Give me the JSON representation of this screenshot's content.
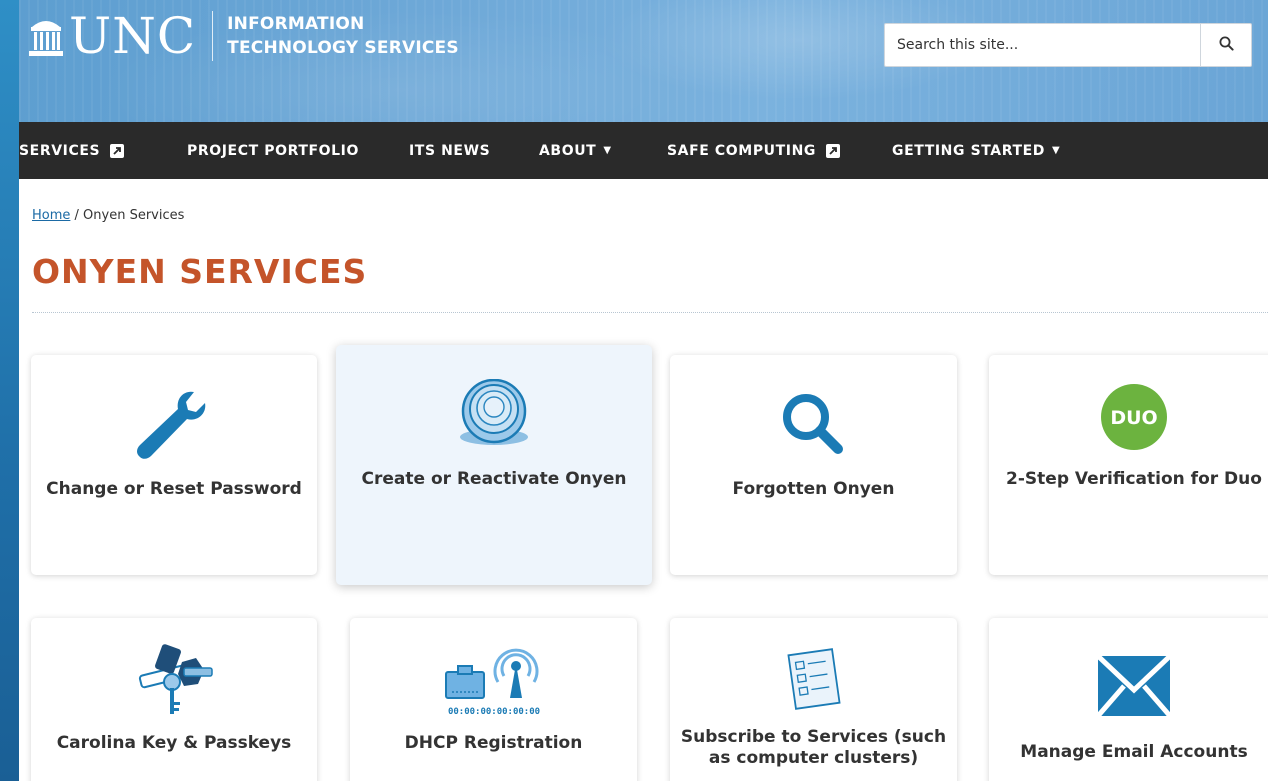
{
  "header": {
    "logo_text": "UNC",
    "department_line1": "INFORMATION",
    "department_line2": "TECHNOLOGY SERVICES"
  },
  "search": {
    "placeholder": "Search this site...",
    "button_icon": "search-icon"
  },
  "nav": {
    "items": [
      {
        "label": "SERVICES",
        "icon": "external-link-icon"
      },
      {
        "label": "PROJECT PORTFOLIO"
      },
      {
        "label": "ITS NEWS"
      },
      {
        "label": "ABOUT",
        "icon": "caret-down-icon"
      },
      {
        "label": "SAFE COMPUTING",
        "icon": "external-link-icon"
      },
      {
        "label": "GETTING STARTED",
        "icon": "caret-down-icon"
      }
    ]
  },
  "breadcrumb": {
    "home": "Home",
    "separator": " / ",
    "current": "Onyen Services"
  },
  "page_title": "ONYEN SERVICES",
  "cards": [
    {
      "label": "Change or Reset Password",
      "icon": "wrench-icon"
    },
    {
      "label": "Create or Reactivate Onyen",
      "icon": "onyen-ring-icon"
    },
    {
      "label": "Forgotten Onyen",
      "icon": "magnifier-icon"
    },
    {
      "label": "2-Step Verification for Duo",
      "icon": "duo-logo-icon",
      "icon_text": "DUO"
    },
    {
      "label": "Carolina Key & Passkeys",
      "icon": "keys-icon"
    },
    {
      "label": "DHCP Registration",
      "icon": "network-antenna-icon",
      "icon_text": "00:00:00:00:00:00"
    },
    {
      "label": "Subscribe to Services (such as computer clusters)",
      "icon": "form-list-icon"
    },
    {
      "label": "Manage Email Accounts",
      "icon": "envelope-icon"
    }
  ],
  "colors": {
    "accent_blue": "#1b7bb5",
    "title_orange": "#c4542a",
    "nav_bg": "#2a2a2a",
    "duo_green": "#6cb33f",
    "hover_card_bg": "#eef5fc"
  }
}
